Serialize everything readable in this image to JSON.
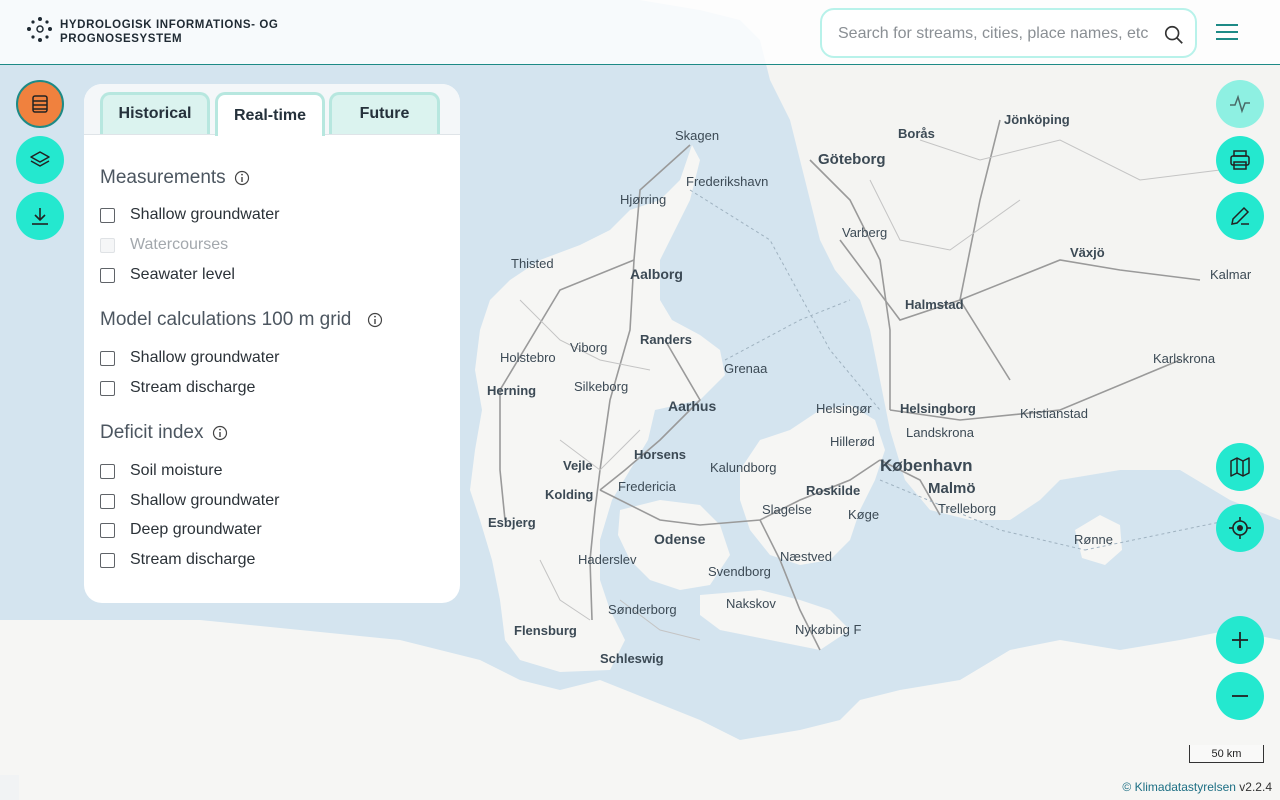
{
  "header": {
    "brand_line1": "HYDROLOGISK INFORMATIONS- OG",
    "brand_line2": "PROGNOSESYSTEM",
    "search_placeholder": "Search for streams, cities, place names, etc."
  },
  "colors": {
    "accent": "#24e8cf",
    "active_button": "#f0813e",
    "header_border": "#1d8a86",
    "water": "#d4e4ef",
    "land": "#f5f5f3"
  },
  "left_toolbar": [
    {
      "name": "list-icon",
      "active": true
    },
    {
      "name": "layers-icon",
      "active": false
    },
    {
      "name": "download-icon",
      "active": false
    }
  ],
  "panel": {
    "tabs": [
      {
        "label": "Historical",
        "active": false
      },
      {
        "label": "Real-time",
        "active": true
      },
      {
        "label": "Future",
        "active": false
      }
    ],
    "sections": [
      {
        "title": "Measurements",
        "options": [
          {
            "label": "Shallow groundwater",
            "checked": false,
            "disabled": false
          },
          {
            "label": "Watercourses",
            "checked": false,
            "disabled": true
          },
          {
            "label": "Seawater level",
            "checked": false,
            "disabled": false
          }
        ]
      },
      {
        "title": "Model calculations 100 m grid",
        "options": [
          {
            "label": "Shallow groundwater",
            "checked": false,
            "disabled": false
          },
          {
            "label": "Stream discharge",
            "checked": false,
            "disabled": false
          }
        ]
      },
      {
        "title": "Deficit index",
        "options": [
          {
            "label": "Soil moisture",
            "checked": false,
            "disabled": false
          },
          {
            "label": "Shallow groundwater",
            "checked": false,
            "disabled": false
          },
          {
            "label": "Deep groundwater",
            "checked": false,
            "disabled": false
          },
          {
            "label": "Stream discharge",
            "checked": false,
            "disabled": false
          }
        ]
      }
    ]
  },
  "right_toolbar": [
    "graph-icon",
    "print-icon",
    "edit-icon",
    "map-icon",
    "locate-icon",
    "zoom-in-icon",
    "zoom-out-icon"
  ],
  "map_labels": [
    "Skagen",
    "Frederikshavn",
    "Hjørring",
    "Thisted",
    "Aalborg",
    "Randers",
    "Viborg",
    "Grenaa",
    "Holstebro",
    "Herning",
    "Silkeborg",
    "Aarhus",
    "Horsens",
    "Vejle",
    "Kolding",
    "Fredericia",
    "Esbjerg",
    "Odense",
    "Haderslev",
    "Svendborg",
    "Sønderborg",
    "Flensburg",
    "Schleswig",
    "Nakskov",
    "Nykøbing F",
    "Næstved",
    "Slagelse",
    "Kalundborg",
    "Roskilde",
    "Køge",
    "Hillerød",
    "Helsingør",
    "Helsingborg",
    "København",
    "Malmö",
    "Trelleborg",
    "Landskrona",
    "Kristianstad",
    "Göteborg",
    "Borås",
    "Jönköping",
    "Varberg",
    "Halmstad",
    "Växjö",
    "Kalmar",
    "Karlskrona",
    "Rønne"
  ],
  "scale_label": "50 km",
  "attribution": {
    "link": "© Klimadatastyrelsen",
    "version": "v2.2.4"
  }
}
